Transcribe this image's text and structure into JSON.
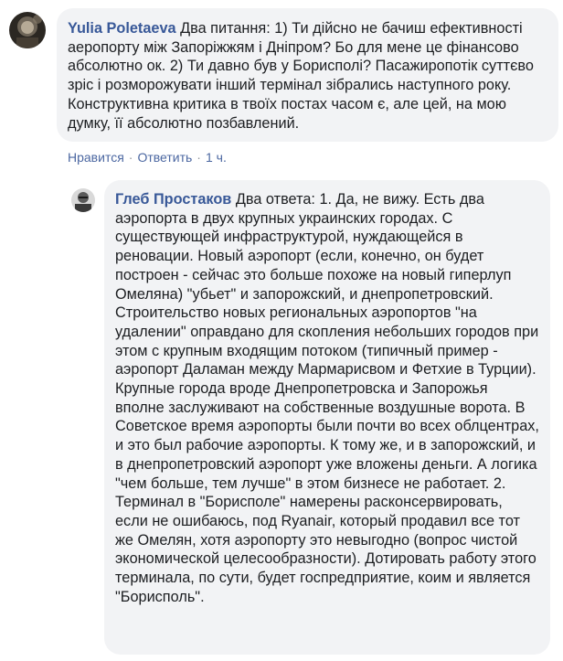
{
  "comments": [
    {
      "author": "Yulia Poletaeva",
      "text": "Два питання: 1) Ти дійсно не бачиш ефективності аеропорту між Запоріжжям і Дніпром? Бо для мене це фінансово абсолютно ок. 2) Ти давно був у Борисполі? Пасажиропотік суттєво зріс і розморожувати інший термінал зібрались наступного року. Конструктивна критика в твоїх постах часом є, але цей, на мою думку, її абсолютно позбавлений.",
      "actions": {
        "like": "Нравится",
        "reply": "Ответить",
        "separator": "·",
        "time": "1 ч."
      }
    },
    {
      "author": "Глеб Простаков",
      "text": "Два ответа: 1. Да, не вижу. Есть два аэропорта в двух крупных украинских городах. С существующей инфраструктурой, нуждающейся в реновации. Новый аэропорт (если, конечно, он будет построен - сейчас это больше похоже на новый гиперлуп Омеляна) \"убьет\" и запорожский, и днепропетровский. Строительство новых региональных аэропортов \"на удалении\" оправдано для скопления небольших городов при этом с крупным входящим потоком (типичный пример - аэропорт Даламан между Мармарисвом и Фетхие в Турции). Крупные города вроде Днепропетровска и Запорожья вполне заслуживают на собственные воздушные ворота. В Советское время аэропорты были почти во всех облцентрах, и это был рабочие аэропорты. К тому же, и в запорожский, и в днепропетровский аэропорт уже вложены деньги. А логика \"чем больше, тем лучше\" в этом бизнесе не работает. 2. Терминал в \"Борисполе\" намерены расконсервировать, если не ошибаюсь, под Ryanair, который продавил все тот же Омелян, хотя аэропорту это невыгодно (вопрос чистой экономической целесообразности). Дотировать работу этого терминала, по сути, будет госпредприятие, коим и является \"Борисполь\"."
    }
  ],
  "colors": {
    "author_link": "#385898",
    "bubble_bg": "#f2f3f5",
    "action_link": "#4b67a1",
    "meta_text": "#90949c"
  },
  "icons": [
    "avatar-yulia",
    "avatar-gleb"
  ]
}
